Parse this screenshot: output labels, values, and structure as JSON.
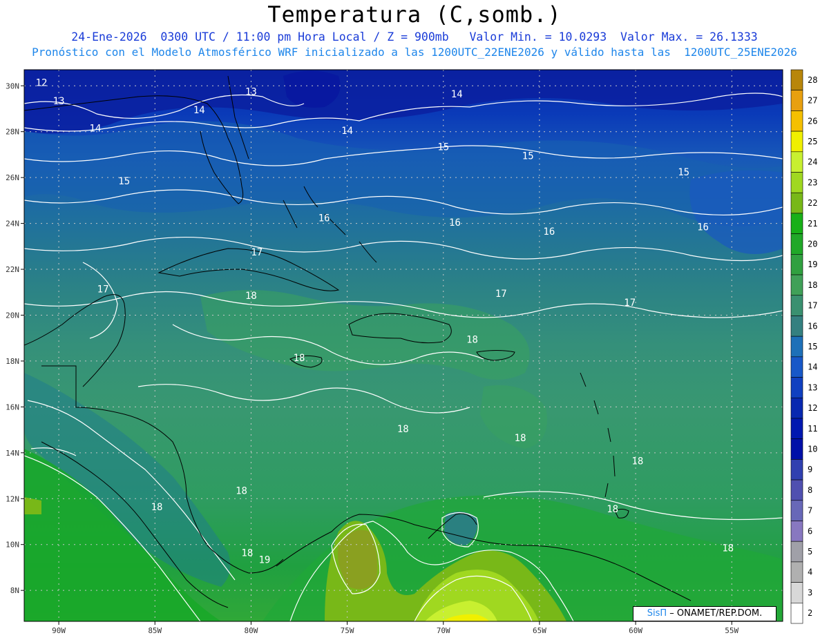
{
  "header": {
    "title": "Temperatura (C,somb.)",
    "subtitle": "24-Ene-2026  0300 UTC / 11:00 pm Hora Local / Z = 900mb   Valor Min. = 10.0293  Valor Max. = 26.1333",
    "forecast": "Pronóstico con el Modelo Atmosférico WRF inicializado a las 1200UTC_22ENE2026 y válido hasta las  1200UTC_25ENE2026"
  },
  "axes": {
    "lon_labels": [
      "90W",
      "85W",
      "80W",
      "75W",
      "70W",
      "65W",
      "60W",
      "55W"
    ],
    "lat_labels": [
      "30N",
      "28N",
      "26N",
      "24N",
      "22N",
      "20N",
      "18N",
      "16N",
      "14N",
      "12N",
      "10N",
      "8N"
    ]
  },
  "colorbar": {
    "levels": [
      28,
      27,
      26,
      25,
      24,
      23,
      22,
      21,
      20,
      19,
      18,
      17,
      16,
      15,
      14,
      13,
      12,
      11,
      10,
      9,
      8,
      7,
      6,
      5,
      4,
      3,
      2
    ],
    "colors": [
      "#b8860b",
      "#e8a010",
      "#f5c000",
      "#f0f000",
      "#c8f030",
      "#a0d820",
      "#78b818",
      "#18b018",
      "#20a828",
      "#30a040",
      "#40a058",
      "#3a9070",
      "#358080",
      "#1e70b8",
      "#1858c8",
      "#1040c0",
      "#0828b0",
      "#0018b0",
      "#0010a8",
      "#3040b0",
      "#5050b0",
      "#6868b8",
      "#8878c0",
      "#a0a0a8",
      "#b0b0b0",
      "#d8d8d8",
      "#ffffff"
    ]
  },
  "contour_labels": [
    {
      "text": "12",
      "lon": -90.9,
      "lat": 30.0
    },
    {
      "text": "13",
      "lon": -80.0,
      "lat": 29.6
    },
    {
      "text": "13",
      "lon": -90.0,
      "lat": 29.2
    },
    {
      "text": "14",
      "lon": -69.3,
      "lat": 29.5
    },
    {
      "text": "14",
      "lon": -82.7,
      "lat": 28.8
    },
    {
      "text": "14",
      "lon": -88.1,
      "lat": 28.0
    },
    {
      "text": "14",
      "lon": -75.0,
      "lat": 27.9
    },
    {
      "text": "15",
      "lon": -70.0,
      "lat": 27.2
    },
    {
      "text": "15",
      "lon": -65.6,
      "lat": 26.8
    },
    {
      "text": "15",
      "lon": -57.5,
      "lat": 26.1
    },
    {
      "text": "15",
      "lon": -86.6,
      "lat": 25.7
    },
    {
      "text": "16",
      "lon": -76.2,
      "lat": 24.1
    },
    {
      "text": "16",
      "lon": -69.4,
      "lat": 23.9
    },
    {
      "text": "16",
      "lon": -64.5,
      "lat": 23.5
    },
    {
      "text": "16",
      "lon": -56.5,
      "lat": 23.7
    },
    {
      "text": "17",
      "lon": -79.7,
      "lat": 22.6
    },
    {
      "text": "17",
      "lon": -87.7,
      "lat": 21.0
    },
    {
      "text": "17",
      "lon": -67.0,
      "lat": 20.8
    },
    {
      "text": "17",
      "lon": -60.3,
      "lat": 20.4
    },
    {
      "text": "18",
      "lon": -80.0,
      "lat": 20.7
    },
    {
      "text": "18",
      "lon": -68.5,
      "lat": 18.8
    },
    {
      "text": "18",
      "lon": -77.5,
      "lat": 18.0
    },
    {
      "text": "18",
      "lon": -72.1,
      "lat": 14.9
    },
    {
      "text": "18",
      "lon": -66.0,
      "lat": 14.5
    },
    {
      "text": "18",
      "lon": -59.9,
      "lat": 13.5
    },
    {
      "text": "18",
      "lon": -80.5,
      "lat": 12.2
    },
    {
      "text": "18",
      "lon": -84.9,
      "lat": 11.5
    },
    {
      "text": "18",
      "lon": -61.2,
      "lat": 11.4
    },
    {
      "text": "18",
      "lon": -80.2,
      "lat": 9.5
    },
    {
      "text": "18",
      "lon": -55.2,
      "lat": 9.7
    },
    {
      "text": "19",
      "lon": -79.3,
      "lat": 9.2
    }
  ],
  "credit": {
    "brand": "SisΠ",
    "text": " – ONAMET/REP.DOM."
  }
}
